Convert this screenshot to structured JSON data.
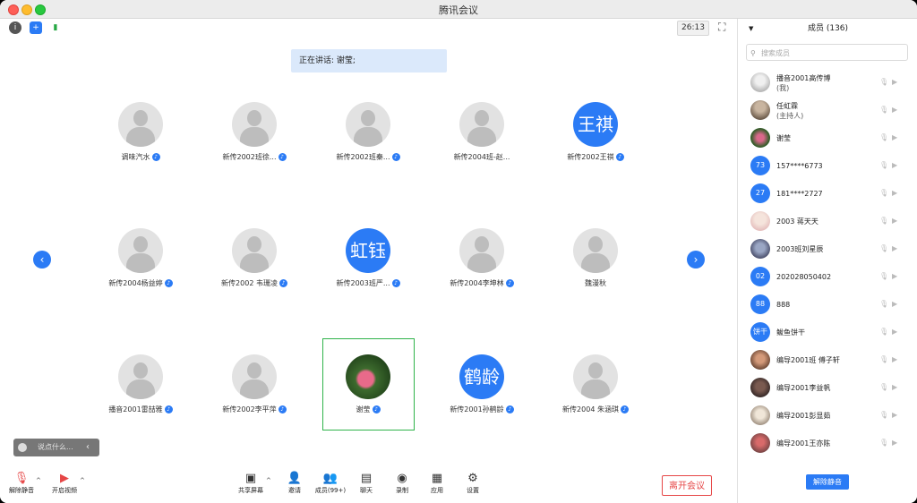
{
  "window": {
    "title": "腾讯会议"
  },
  "topbar": {
    "timer": "26:13"
  },
  "speaker": {
    "text": "正在讲话: 谢莹;"
  },
  "tiles": [
    {
      "name": "调味汽水",
      "kind": "default",
      "avatar_text": ""
    },
    {
      "name": "新传2002班徐...",
      "kind": "default",
      "avatar_text": ""
    },
    {
      "name": "新传2002班秦...",
      "kind": "default",
      "avatar_text": ""
    },
    {
      "name": "新传2004班-赵...",
      "kind": "default",
      "avatar_text": ""
    },
    {
      "name": "新传2002王祺",
      "kind": "text",
      "avatar_text": "王祺"
    },
    {
      "name": "新传2004杨益婷",
      "kind": "default",
      "avatar_text": ""
    },
    {
      "name": "新传2002 韦珊凌",
      "kind": "default",
      "avatar_text": ""
    },
    {
      "name": "新传2003班严...",
      "kind": "text",
      "avatar_text": "虹钰"
    },
    {
      "name": "新传2004李坤林",
      "kind": "default",
      "avatar_text": ""
    },
    {
      "name": "魏漫秋",
      "kind": "default",
      "avatar_text": ""
    },
    {
      "name": "播音2001雷喆雅",
      "kind": "default",
      "avatar_text": ""
    },
    {
      "name": "新传2002李平萍",
      "kind": "default",
      "avatar_text": ""
    },
    {
      "name": "谢莹",
      "kind": "photo",
      "avatar_text": ""
    },
    {
      "name": "新传2001孙鹤龄",
      "kind": "text",
      "avatar_text": "鹤龄"
    },
    {
      "name": "新传2004 朱涵琪",
      "kind": "default",
      "avatar_text": ""
    }
  ],
  "chat": {
    "placeholder": "说点什么..."
  },
  "toolbar": {
    "unmute": "解除静音",
    "video": "开启视频",
    "share": "共享屏幕",
    "invite": "邀请",
    "members": "成员(99+)",
    "chat": "聊天",
    "record": "录制",
    "apps": "应用",
    "settings": "设置",
    "leave": "离开会议"
  },
  "panel": {
    "title": "成员 (136)",
    "search_placeholder": "搜索成员",
    "unmute_all": "解除静音",
    "members": [
      {
        "name": "播音2001高传博",
        "sub": "(我)",
        "avatar": "img1",
        "avatar_text": ""
      },
      {
        "name": "任虹霖",
        "sub": "(主持人)",
        "avatar": "img2",
        "avatar_text": ""
      },
      {
        "name": "谢莹",
        "sub": "",
        "avatar": "img3",
        "avatar_text": ""
      },
      {
        "name": "157****6773",
        "sub": "",
        "avatar": "blue",
        "avatar_text": "73"
      },
      {
        "name": "181****2727",
        "sub": "",
        "avatar": "blue",
        "avatar_text": "27"
      },
      {
        "name": "2003 蒋天天",
        "sub": "",
        "avatar": "img4",
        "avatar_text": ""
      },
      {
        "name": "2003班刘星辰",
        "sub": "",
        "avatar": "img5",
        "avatar_text": ""
      },
      {
        "name": "202028050402",
        "sub": "",
        "avatar": "blue",
        "avatar_text": "02"
      },
      {
        "name": "888",
        "sub": "",
        "avatar": "blue",
        "avatar_text": "88"
      },
      {
        "name": "鲅鱼饼干",
        "sub": "",
        "avatar": "blue",
        "avatar_text": "饼干"
      },
      {
        "name": "编导2001班 傅子轩",
        "sub": "",
        "avatar": "img6",
        "avatar_text": ""
      },
      {
        "name": "编导2001李益帆",
        "sub": "",
        "avatar": "img7",
        "avatar_text": ""
      },
      {
        "name": "编导2001彭显茹",
        "sub": "",
        "avatar": "img8",
        "avatar_text": ""
      },
      {
        "name": "编导2001王亦陈",
        "sub": "",
        "avatar": "img9",
        "avatar_text": ""
      }
    ]
  }
}
